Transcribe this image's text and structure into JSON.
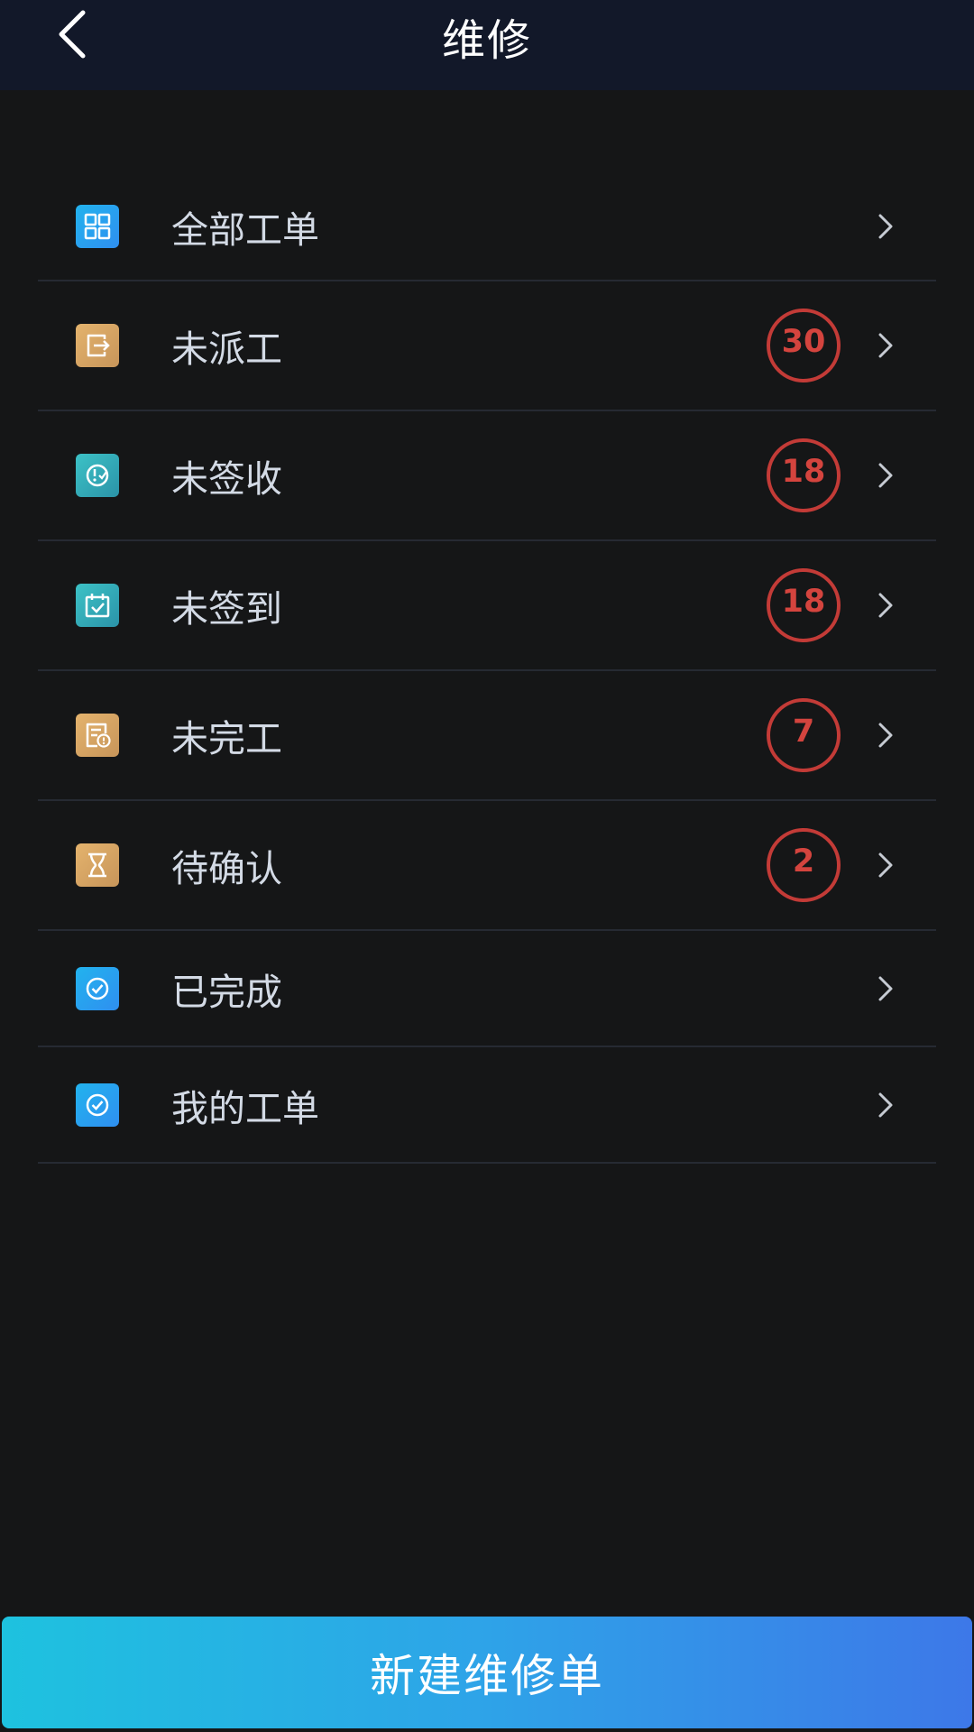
{
  "header": {
    "title": "维修",
    "back_icon": "chevron-left-icon"
  },
  "colors": {
    "background": "#151617",
    "header_bg": "#121829",
    "badge_red": "#c33b37",
    "icon_blue": "#22b3ee",
    "icon_gold": "#e4b36d",
    "icon_teal": "#3cc2c6",
    "button_gradient_start": "#1ec2df",
    "button_gradient_end": "#3d78e8"
  },
  "menu": {
    "items": [
      {
        "label": "全部工单",
        "icon": "grid-icon",
        "badge": null
      },
      {
        "label": "未派工",
        "icon": "dispatch-exit-icon",
        "badge": "30"
      },
      {
        "label": "未签收",
        "icon": "clock-check-icon",
        "badge": "18"
      },
      {
        "label": "未签到",
        "icon": "calendar-check-icon",
        "badge": "18"
      },
      {
        "label": "未完工",
        "icon": "document-alert-icon",
        "badge": "7"
      },
      {
        "label": "待确认",
        "icon": "hourglass-icon",
        "badge": "2"
      },
      {
        "label": "已完成",
        "icon": "check-circle-icon",
        "badge": null
      },
      {
        "label": "我的工单",
        "icon": "check-circle-icon",
        "badge": null
      }
    ]
  },
  "footer": {
    "create_label": "新建维修单"
  }
}
